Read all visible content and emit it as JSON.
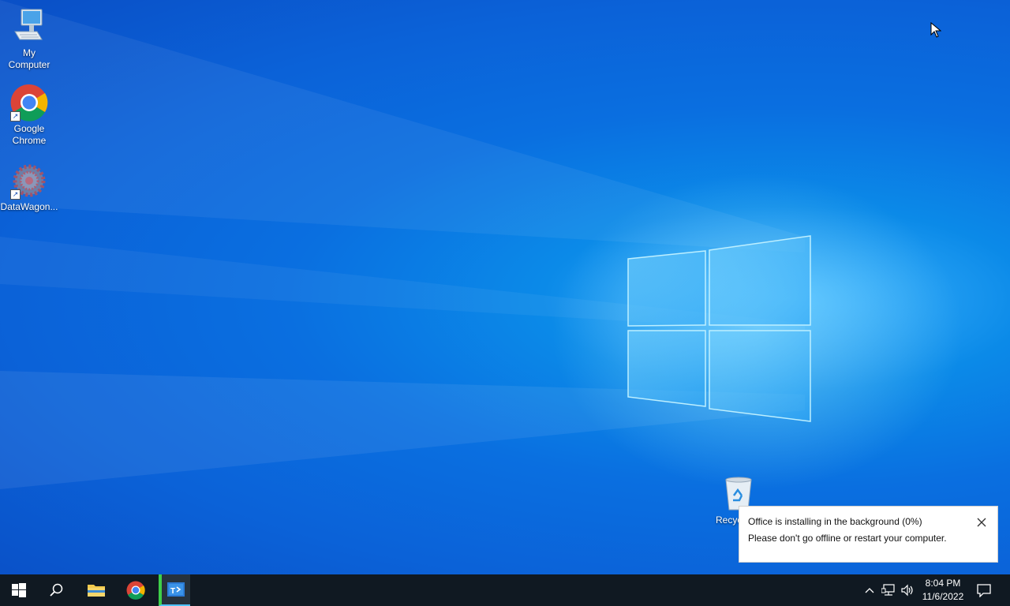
{
  "desktop": {
    "icons": [
      {
        "label": "My\nComputer",
        "icon": "computer-icon"
      },
      {
        "label": "Google\nChrome",
        "icon": "chrome-icon"
      },
      {
        "label": "DataWagon...",
        "icon": "datawagon-icon"
      },
      {
        "label": "Recyc",
        "icon": "recycle-bin-icon"
      }
    ]
  },
  "toast": {
    "line1": "Office is installing in the background (0%)",
    "line2": "Please don't go offline or restart your computer."
  },
  "taskbar": {
    "apps": [
      "start-icon",
      "search-icon",
      "file-explorer-icon",
      "chrome-icon",
      "remote-app-icon"
    ],
    "tray": [
      "chevron-up-icon",
      "network-icon",
      "volume-icon"
    ]
  },
  "clock": {
    "time": "8:04 PM",
    "date": "11/6/2022"
  },
  "colors": {
    "accent": "#4fc3ff",
    "taskbar": "#101922",
    "wallpaper": "#0a6fe0"
  }
}
